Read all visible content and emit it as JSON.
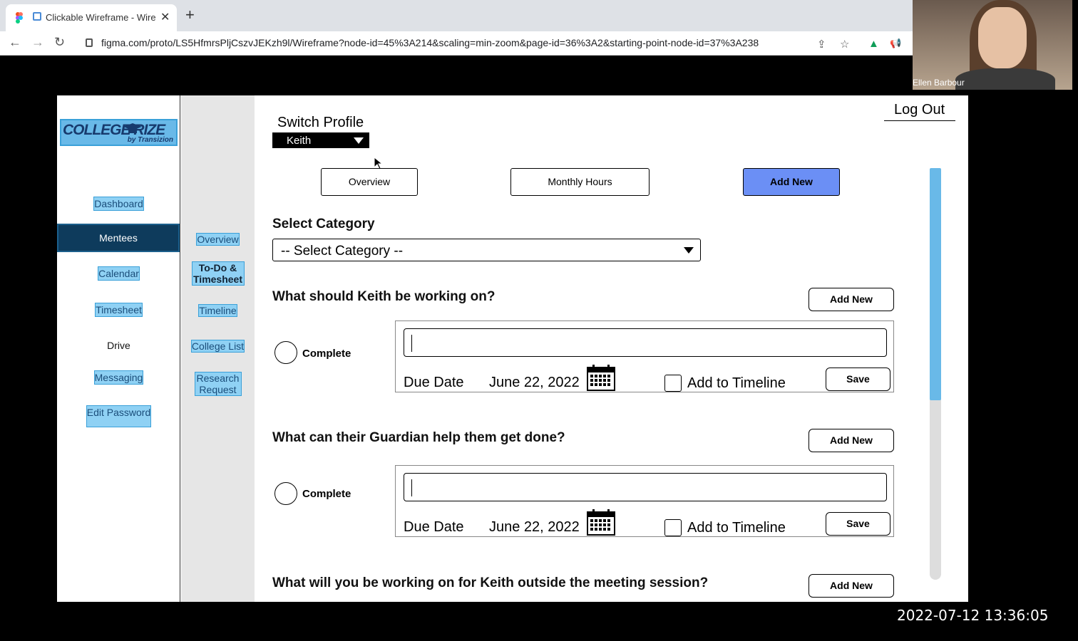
{
  "browser": {
    "tab_title": "Clickable Wireframe - Wire",
    "tab_close": "✕",
    "new_tab": "+",
    "url": "figma.com/proto/LS5HfmrsPljCszvJEKzh9l/Wireframe?node-id=45%3A214&scaling=min-zoom&page-id=36%3A2&starting-point-node-id=37%3A238",
    "back": "←",
    "forward": "→",
    "reload": "↻",
    "share": "⇪",
    "star": "☆",
    "drive": "▲",
    "announce": "📢"
  },
  "webcam": {
    "name": "Ellen Barbour"
  },
  "sidebar": {
    "logo_top": "COLLEGE  RIZE",
    "logo_sub": "by Transizion",
    "items": [
      "Dashboard",
      "Mentees",
      "Calendar",
      "Timesheet",
      "Drive",
      "Messaging",
      "Edit Password"
    ]
  },
  "subnav": {
    "items": [
      "Overview",
      "To-Do & Timesheet",
      "Timeline",
      "College List",
      "Research Request"
    ]
  },
  "main": {
    "switch_profile": "Switch Profile",
    "profile_value": "Keith",
    "log_out": "Log Out",
    "tabs": [
      "Overview",
      "Monthly Hours",
      "Add New"
    ],
    "select_category_label": "Select Category",
    "select_category_value": "-- Select Category --",
    "sections": [
      {
        "question": "What should  Keith be working on?",
        "add_new": "Add New",
        "complete": "Complete",
        "due_label": "Due Date",
        "due_value": "June 22, 2022",
        "timeline": "Add to Timeline",
        "save": "Save"
      },
      {
        "question": "What can their Guardian help them get done?",
        "add_new": "Add New",
        "complete": "Complete",
        "due_label": "Due Date",
        "due_value": "June 22, 2022",
        "timeline": "Add to Timeline",
        "save": "Save"
      },
      {
        "question": "What will you be working on for Keith outside the meeting session?",
        "add_new": "Add New"
      }
    ]
  },
  "timestamp": "2022-07-12 13:36:05",
  "colors": {
    "accent_blue": "#6b8ff5",
    "nav_active": "#0e3b5c",
    "nav_highlight": "#8fd1f4",
    "scroll_thumb": "#69b9e8"
  }
}
